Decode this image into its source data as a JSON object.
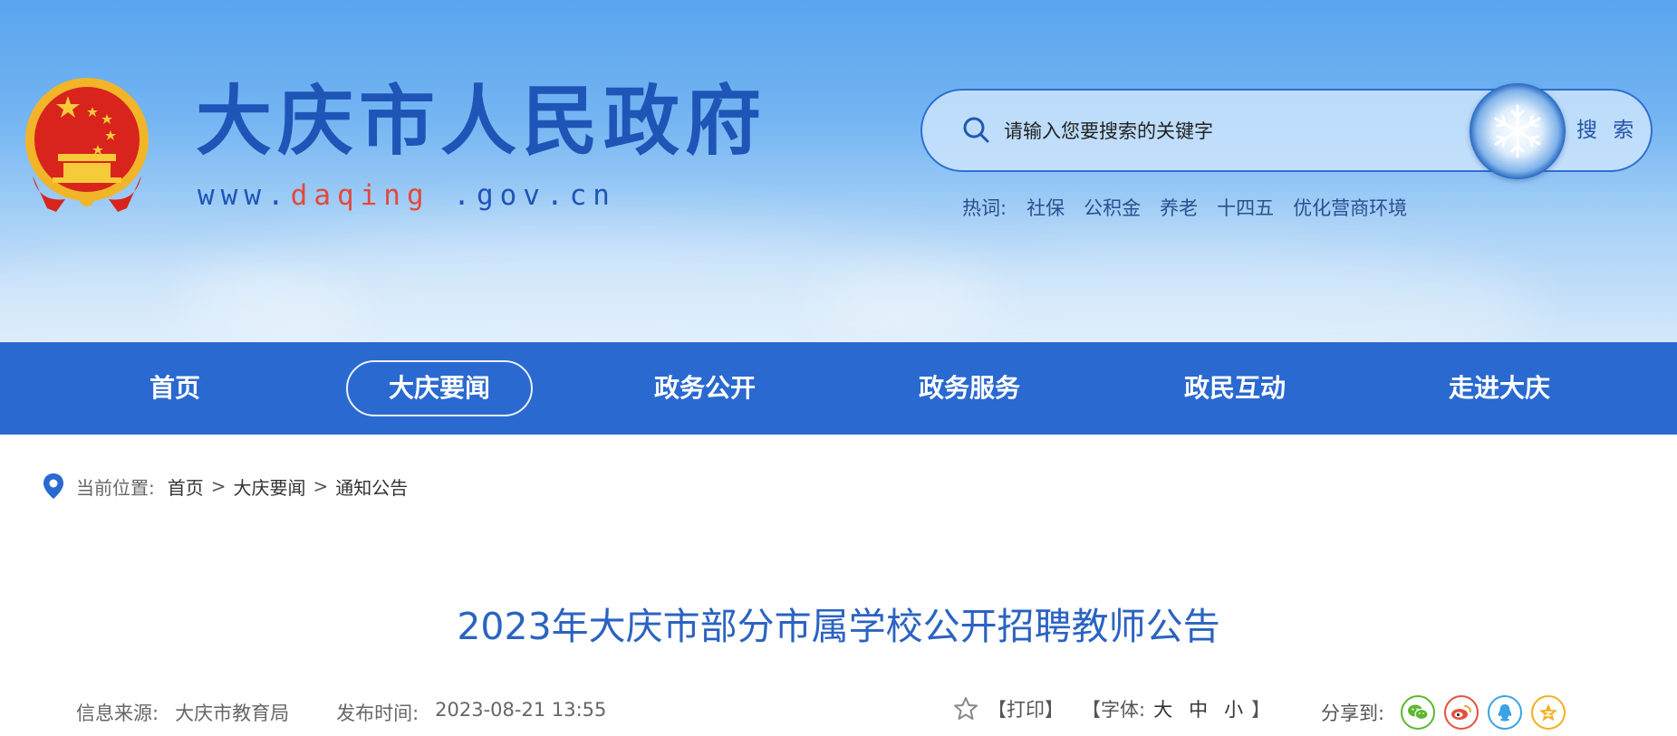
{
  "header": {
    "site_title": "大庆市人民政府",
    "url_prefix": "www.",
    "url_accent": "daqing",
    "url_suffix": " .gov.cn"
  },
  "search": {
    "placeholder": "请输入您要搜索的关键字",
    "button_label": "搜 索"
  },
  "hot_words": {
    "label": "热词:",
    "items": [
      "社保",
      "公积金",
      "养老",
      "十四五",
      "优化营商环境"
    ]
  },
  "nav": {
    "items": [
      "首页",
      "大庆要闻",
      "政务公开",
      "政务服务",
      "政民互动",
      "走进大庆"
    ],
    "active": "大庆要闻"
  },
  "breadcrumb": {
    "label": "当前位置:",
    "items": [
      "首页",
      "大庆要闻",
      "通知公告"
    ],
    "separator": ">"
  },
  "article": {
    "title": "2023年大庆市部分市属学校公开招聘教师公告",
    "source_label": "信息来源:",
    "source_value": "大庆市教育局",
    "time_label": "发布时间:",
    "time_value": "2023-08-21 13:55"
  },
  "tools": {
    "print": "【打印】",
    "font_label": "【字体:",
    "font_sizes": [
      "大",
      "中",
      "小"
    ],
    "font_close": "】",
    "share_label": "分享到:"
  },
  "colors": {
    "nav_bg": "#2a69d0",
    "title_blue": "#1f55b6",
    "accent_red": "#e4483a",
    "wechat": "#5cb82e",
    "weibo": "#e6503d",
    "qq": "#3aa2e6",
    "qzone": "#f2b01e"
  }
}
